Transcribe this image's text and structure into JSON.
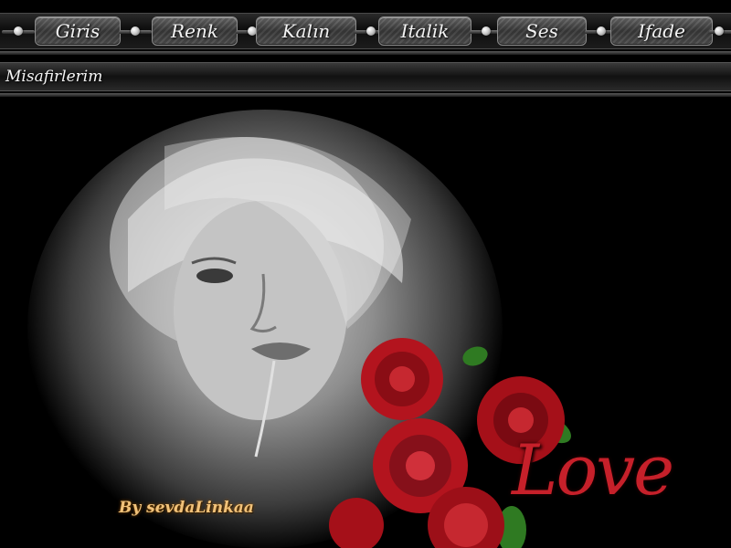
{
  "nav": {
    "items": [
      {
        "label": "Giris"
      },
      {
        "label": "Renk"
      },
      {
        "label": "Kalın"
      },
      {
        "label": "Italik"
      },
      {
        "label": "Ses"
      },
      {
        "label": "Ifade"
      }
    ]
  },
  "guests": {
    "label": "Misafirlerim"
  },
  "artwork": {
    "love_text": "Love",
    "signature": "By sevdaLinkaa",
    "colors": {
      "rose": "#b3141e",
      "leaf": "#2f7a22",
      "signature": "#f1c27a"
    }
  }
}
